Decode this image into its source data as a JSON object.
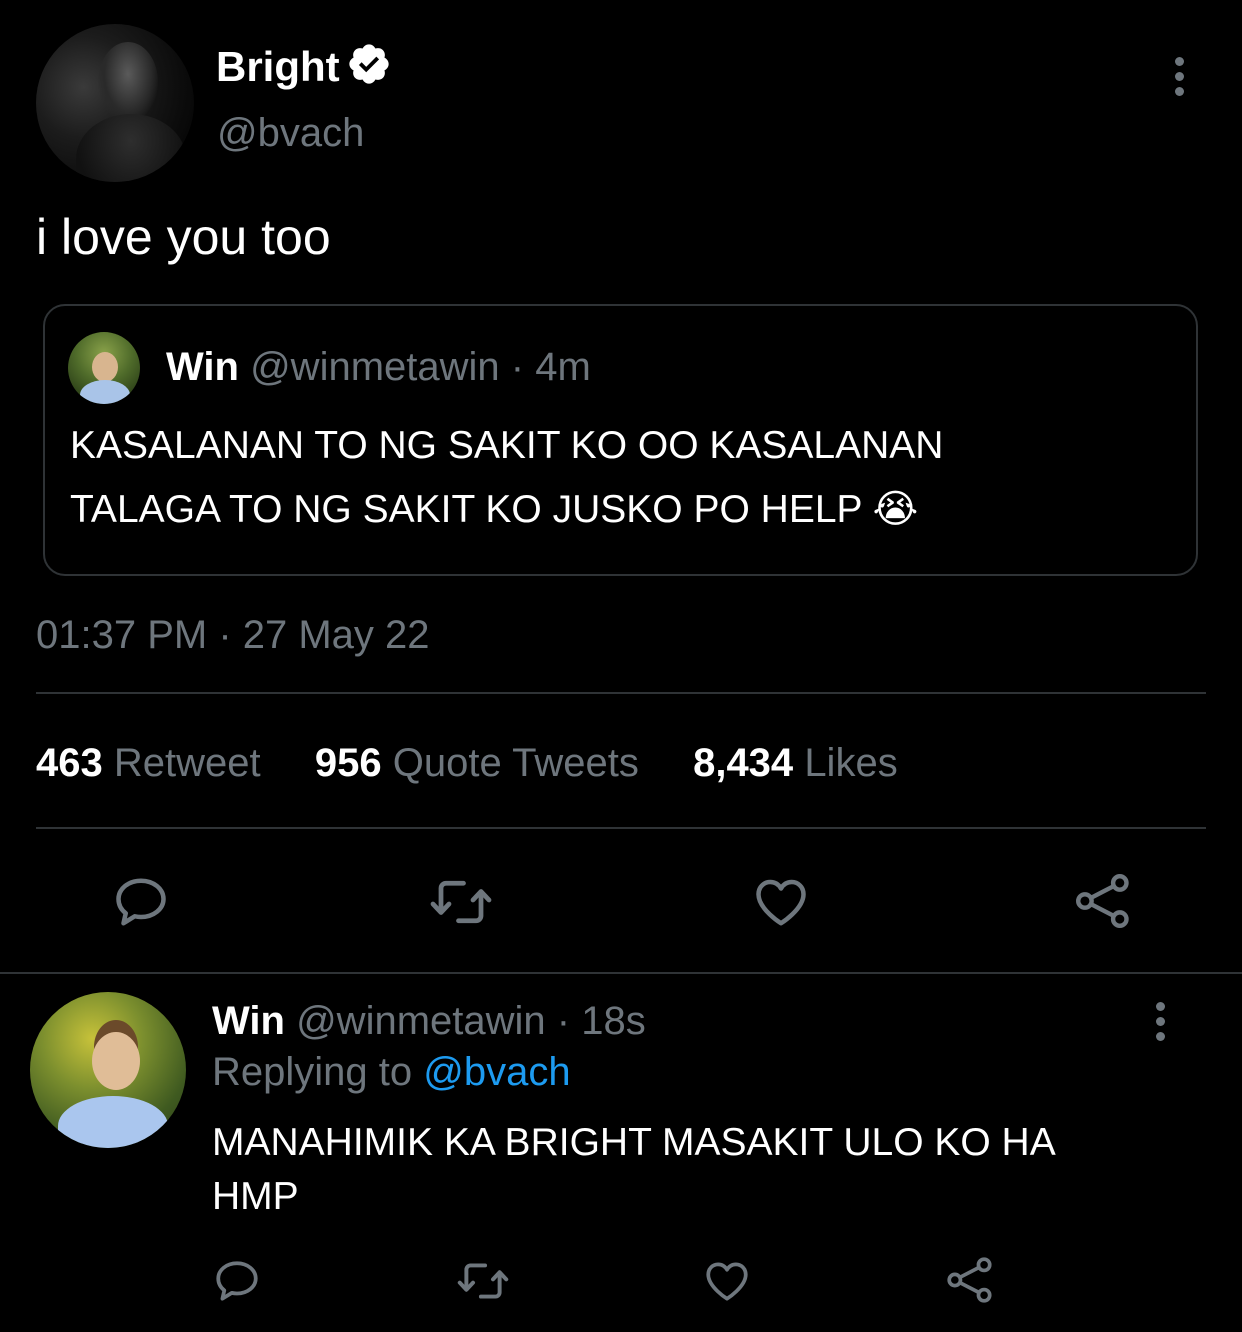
{
  "main_tweet": {
    "author_name": "Bright",
    "author_handle": "@bvach",
    "text": "i love you too",
    "timestamp": "01:37 PM · 27 May 22",
    "stats": {
      "retweets_count": "463",
      "retweets_label": "Retweet",
      "quotes_count": "956",
      "quotes_label": "Quote Tweets",
      "likes_count": "8,434",
      "likes_label": "Likes"
    }
  },
  "quoted_tweet": {
    "author_name": "Win",
    "author_handle": "@winmetawin",
    "separator": "·",
    "time": "4m",
    "text_line1": "KASALANAN TO NG SAKIT KO OO KASALANAN",
    "text_line2": "TALAGA TO NG SAKIT KO JUSKO PO HELP",
    "emoji": "😭"
  },
  "reply": {
    "author_name": "Win",
    "author_handle": "@winmetawin",
    "separator": "·",
    "time": "18s",
    "replying_label": "Replying to",
    "replying_handle": "@bvach",
    "text_line1": "MANAHIMIK KA BRIGHT MASAKIT ULO KO HA",
    "text_line2": "HMP"
  },
  "icons": {
    "reply": "reply-icon",
    "retweet": "retweet-icon",
    "like": "heart-icon",
    "share": "share-icon",
    "more": "more-icon",
    "verified": "verified-badge-icon"
  },
  "colors": {
    "background": "#000000",
    "muted": "#6e767d",
    "link": "#1d9bf0",
    "divider": "#2f3336"
  }
}
